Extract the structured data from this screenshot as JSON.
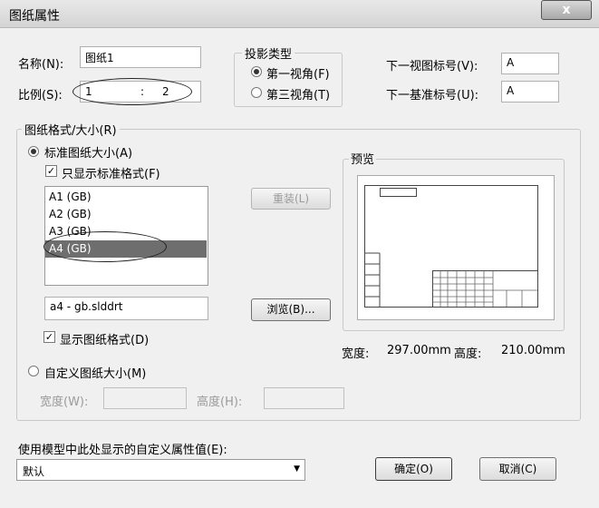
{
  "window": {
    "title": "图纸属性",
    "close": "x"
  },
  "name": {
    "label": "名称(N):",
    "value": "图纸1"
  },
  "scale": {
    "label": "比例(S):",
    "left": "1",
    "sep": ":",
    "right": "2"
  },
  "projection": {
    "title": "投影类型",
    "first": "第一视角(F)",
    "third": "第三视角(T)"
  },
  "next_view": {
    "label": "下一视图标号(V):",
    "value": "A"
  },
  "next_datum": {
    "label": "下一基准标号(U):",
    "value": "A"
  },
  "format_group": {
    "title": "图纸格式/大小(R)"
  },
  "standard": {
    "label": "标准图纸大小(A)",
    "only_standard": "只显示标准格式(F)"
  },
  "sizes": [
    "A1 (GB)",
    "A2 (GB)",
    "A3 (GB)",
    "A4 (GB)"
  ],
  "reload_button": "重装(L)",
  "format_file": "a4 - gb.slddrt",
  "browse_button": "浏览(B)...",
  "show_format": "显示图纸格式(D)",
  "custom": {
    "label": "自定义图纸大小(M)",
    "width_label": "宽度(W):",
    "height_label": "高度(H):"
  },
  "preview": {
    "label": "预览",
    "width_label": "宽度:",
    "width": "297.00mm",
    "height_label": "高度:",
    "height": "210.00mm"
  },
  "custom_prop": {
    "label": "使用模型中此处显示的自定义属性值(E):",
    "value": "默认"
  },
  "buttons": {
    "ok": "确定(O)",
    "cancel": "取消(C)"
  }
}
